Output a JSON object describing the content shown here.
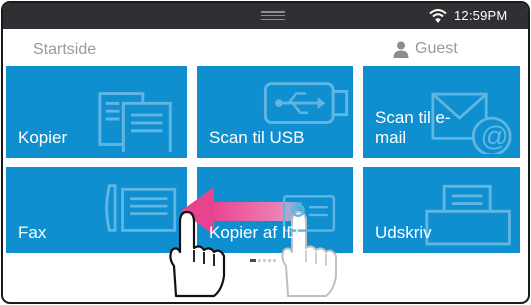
{
  "status_bar": {
    "time": "12:59PM",
    "wifi_icon": "wifi-icon",
    "handle_icon": "pull-down-handle-icon"
  },
  "header": {
    "breadcrumb": "Startside",
    "user_label": "Guest",
    "user_icon": "person-icon"
  },
  "tiles": [
    {
      "label": "Kopier",
      "icon": "copy-documents-icon"
    },
    {
      "label": "Scan til USB",
      "icon": "usb-icon"
    },
    {
      "label": "Scan til e-\nmail",
      "icon": "email-at-icon"
    },
    {
      "label": "Fax",
      "icon": "fax-phone-icon"
    },
    {
      "label": "Kopier af ID",
      "icon": "id-card-icon"
    },
    {
      "label": "Udskriv",
      "icon": "printer-icon"
    }
  ],
  "pager": {
    "pages": 5,
    "current": 1
  },
  "gesture": {
    "arrow_direction": "left",
    "hands": [
      "pointing-hand-icon",
      "pointing-hand-ghost-icon"
    ]
  },
  "colors": {
    "tile": "#0f8fcf",
    "status_bar": "#2f3033",
    "arrow": "#e8438f"
  }
}
